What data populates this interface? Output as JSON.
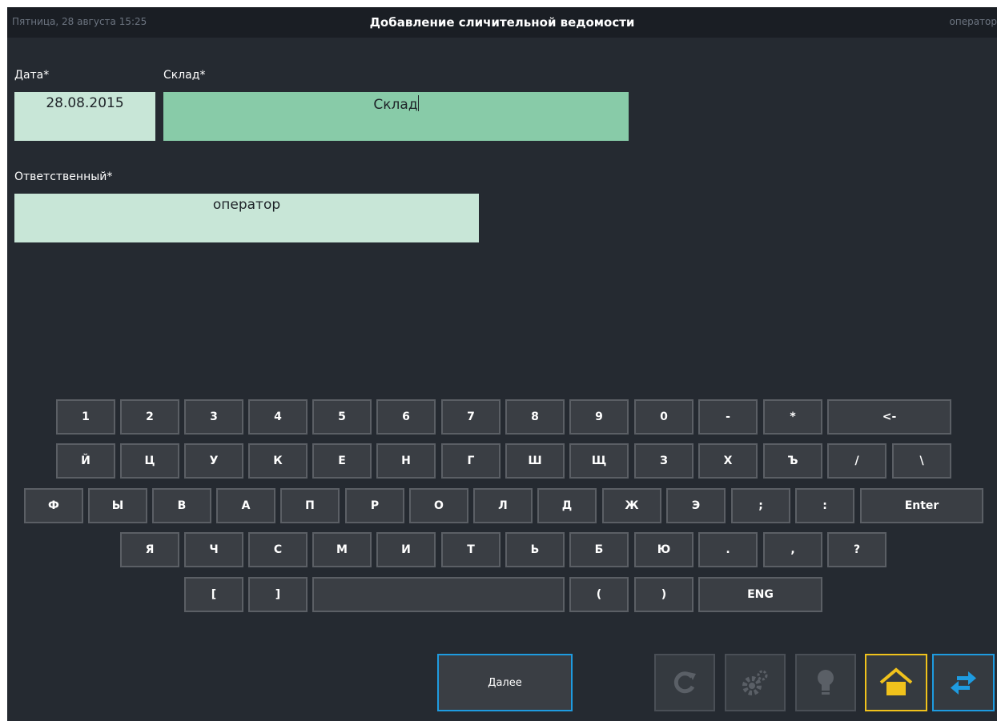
{
  "header": {
    "date_time": "Пятница, 28 августа 15:25",
    "title": "Добавление сличительной ведомости",
    "user": "оператор"
  },
  "form": {
    "date_label": "Дата*",
    "date_value": "28.08.2015",
    "warehouse_label": "Склад*",
    "warehouse_value": "Склад",
    "responsible_label": "Ответственный*",
    "responsible_value": "оператор"
  },
  "keyboard": {
    "row1": [
      "1",
      "2",
      "3",
      "4",
      "5",
      "6",
      "7",
      "8",
      "9",
      "0",
      "-",
      "*",
      "<-"
    ],
    "row2": [
      "Й",
      "Ц",
      "У",
      "К",
      "Е",
      "Н",
      "Г",
      "Ш",
      "Щ",
      "З",
      "Х",
      "Ъ",
      "/",
      "\\"
    ],
    "row3": [
      "Ф",
      "Ы",
      "В",
      "А",
      "П",
      "Р",
      "О",
      "Л",
      "Д",
      "Ж",
      "Э",
      ";",
      ":",
      "Enter"
    ],
    "row4": [
      "Я",
      "Ч",
      "С",
      "М",
      "И",
      "Т",
      "Ь",
      "Б",
      "Ю",
      ".",
      ",",
      "?"
    ],
    "row5": [
      "[",
      "]",
      "",
      "(",
      ")",
      "ENG"
    ]
  },
  "footer": {
    "next_label": "Далее"
  },
  "colors": {
    "background": "#252a31",
    "topbar": "#1a1e24",
    "field_light": "#c8e6d7",
    "field_active": "#88cba8",
    "accent_blue": "#1e9be0",
    "accent_yellow": "#f0c21c"
  }
}
